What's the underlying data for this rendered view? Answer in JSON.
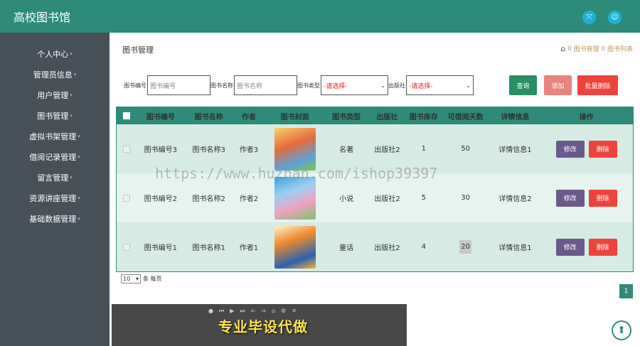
{
  "header": {
    "title": "高校图书馆",
    "fullscreen_icon": "⤧",
    "user_icon": "☺"
  },
  "sidebar": {
    "items": [
      {
        "label": "个人中心"
      },
      {
        "label": "管理员信息"
      },
      {
        "label": "用户管理"
      },
      {
        "label": "图书管理"
      },
      {
        "label": "虚拟书架管理"
      },
      {
        "label": "借阅记录管理"
      },
      {
        "label": "留言管理"
      },
      {
        "label": "资源讲座管理"
      },
      {
        "label": "基础数据管理"
      }
    ]
  },
  "page": {
    "title": "图书管理",
    "breadcrumb": {
      "home_icon": "⌂",
      "sep": "II",
      "level1": "图书管理",
      "level2": "图书列表"
    }
  },
  "filters": {
    "book_no_label": "图书编号",
    "book_no_placeholder": "图书编号",
    "book_name_label": "图书名称",
    "book_name_placeholder": "图书名称",
    "book_type_label": "图书类型",
    "book_type_value": "-请选择-",
    "publisher_label": "出版社",
    "publisher_value": "-请选择-"
  },
  "actions": {
    "query": "查询",
    "add": "添加",
    "batch_delete": "批量删除"
  },
  "table": {
    "headers": [
      "图书编号",
      "图书名称",
      "作者",
      "图书封面",
      "图书类型",
      "出版社",
      "图书库存",
      "可借阅天数",
      "详情信息",
      "操作"
    ],
    "rows": [
      {
        "no": "图书编号3",
        "name": "图书名称3",
        "author": "作者3",
        "type": "名著",
        "publisher": "出版社2",
        "stock": "1",
        "days": "50",
        "detail": "详情信息1"
      },
      {
        "no": "图书编号2",
        "name": "图书名称2",
        "author": "作者2",
        "type": "小说",
        "publisher": "出版社2",
        "stock": "5",
        "days": "30",
        "detail": "详情信息2"
      },
      {
        "no": "图书编号1",
        "name": "图书名称1",
        "author": "作者1",
        "type": "童话",
        "publisher": "出版社2",
        "stock": "4",
        "days": "20",
        "detail": "详情信息1"
      }
    ],
    "edit_label": "修改",
    "delete_label": "删除"
  },
  "pagination": {
    "page_size": "10",
    "page_size_suffix": "条 每页",
    "current_page": "1"
  },
  "overlay": {
    "watermark": "https://www.huzhan.com/ishop39397",
    "subtitle": "专业毕设代做"
  },
  "colors": {
    "primary": "#2e8b7a",
    "sidebar": "#485058",
    "danger": "#f0423c",
    "edit": "#6a5a8c"
  }
}
